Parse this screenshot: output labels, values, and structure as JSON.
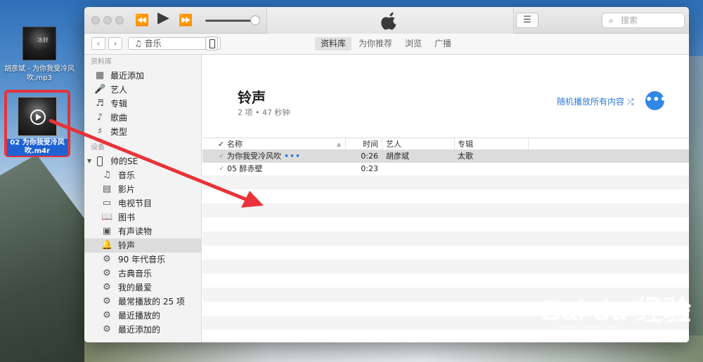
{
  "desktop": {
    "icon1_label": "胡彦斌 - 为你我受冷风吹.mp3",
    "icon2_label": "02 为你我受冷风吹.m4r"
  },
  "toolbar": {
    "prev_icon": "⏪",
    "play_icon": "▶",
    "next_icon": "⏩",
    "list_icon": "☰",
    "search_placeholder": "搜索"
  },
  "nav": {
    "back": "‹",
    "forward": "›",
    "media_type": "♫ 音乐",
    "tabs": [
      {
        "label": "资料库",
        "active": true
      },
      {
        "label": "为你推荐",
        "active": false
      },
      {
        "label": "浏览",
        "active": false
      },
      {
        "label": "广播",
        "active": false
      }
    ]
  },
  "sidebar": {
    "library_header": "资料库",
    "library_items": [
      {
        "label": "最近添加",
        "icon": "▦"
      },
      {
        "label": "艺人",
        "icon": "🎤"
      },
      {
        "label": "专辑",
        "icon": "♬"
      },
      {
        "label": "歌曲",
        "icon": "♪"
      },
      {
        "label": "类型",
        "icon": "♯"
      }
    ],
    "devices_header": "设备",
    "device_name": "帅的SE",
    "device_items": [
      {
        "label": "音乐",
        "icon": "♫"
      },
      {
        "label": "影片",
        "icon": "▤"
      },
      {
        "label": "电视节目",
        "icon": "▭"
      },
      {
        "label": "图书",
        "icon": "📖"
      },
      {
        "label": "有声读物",
        "icon": "▣"
      },
      {
        "label": "铃声",
        "icon": "🔔"
      },
      {
        "label": "90 年代音乐",
        "icon": "⚙"
      },
      {
        "label": "古典音乐",
        "icon": "⚙"
      },
      {
        "label": "我的最爱",
        "icon": "⚙"
      },
      {
        "label": "最常播放的 25 项",
        "icon": "⚙"
      },
      {
        "label": "最近播放的",
        "icon": "⚙"
      },
      {
        "label": "最近添加的",
        "icon": "⚙"
      }
    ]
  },
  "main": {
    "title": "铃声",
    "subtitle": "2 项 • 47 秒钟",
    "shuffle_label": "随机播放所有内容 ⤮",
    "more_label": "•••",
    "columns": {
      "check": "✓",
      "name": "名称",
      "time": "时间",
      "artist": "艺人",
      "album": "专辑"
    },
    "rows": [
      {
        "check": "✓",
        "name": "为你我受冷风吹",
        "more": "•••",
        "time": "0:26",
        "artist": "胡彦斌",
        "album": "太歌"
      },
      {
        "check": "✓",
        "name": "05 醉赤壁",
        "more": "",
        "time": "0:23",
        "artist": "",
        "album": ""
      }
    ]
  },
  "watermark": {
    "brand": "Bai du 经验",
    "url": "jingyan.baidu.com"
  },
  "colors": {
    "accent": "#2f7bd7",
    "annotation": "#e8333a"
  }
}
